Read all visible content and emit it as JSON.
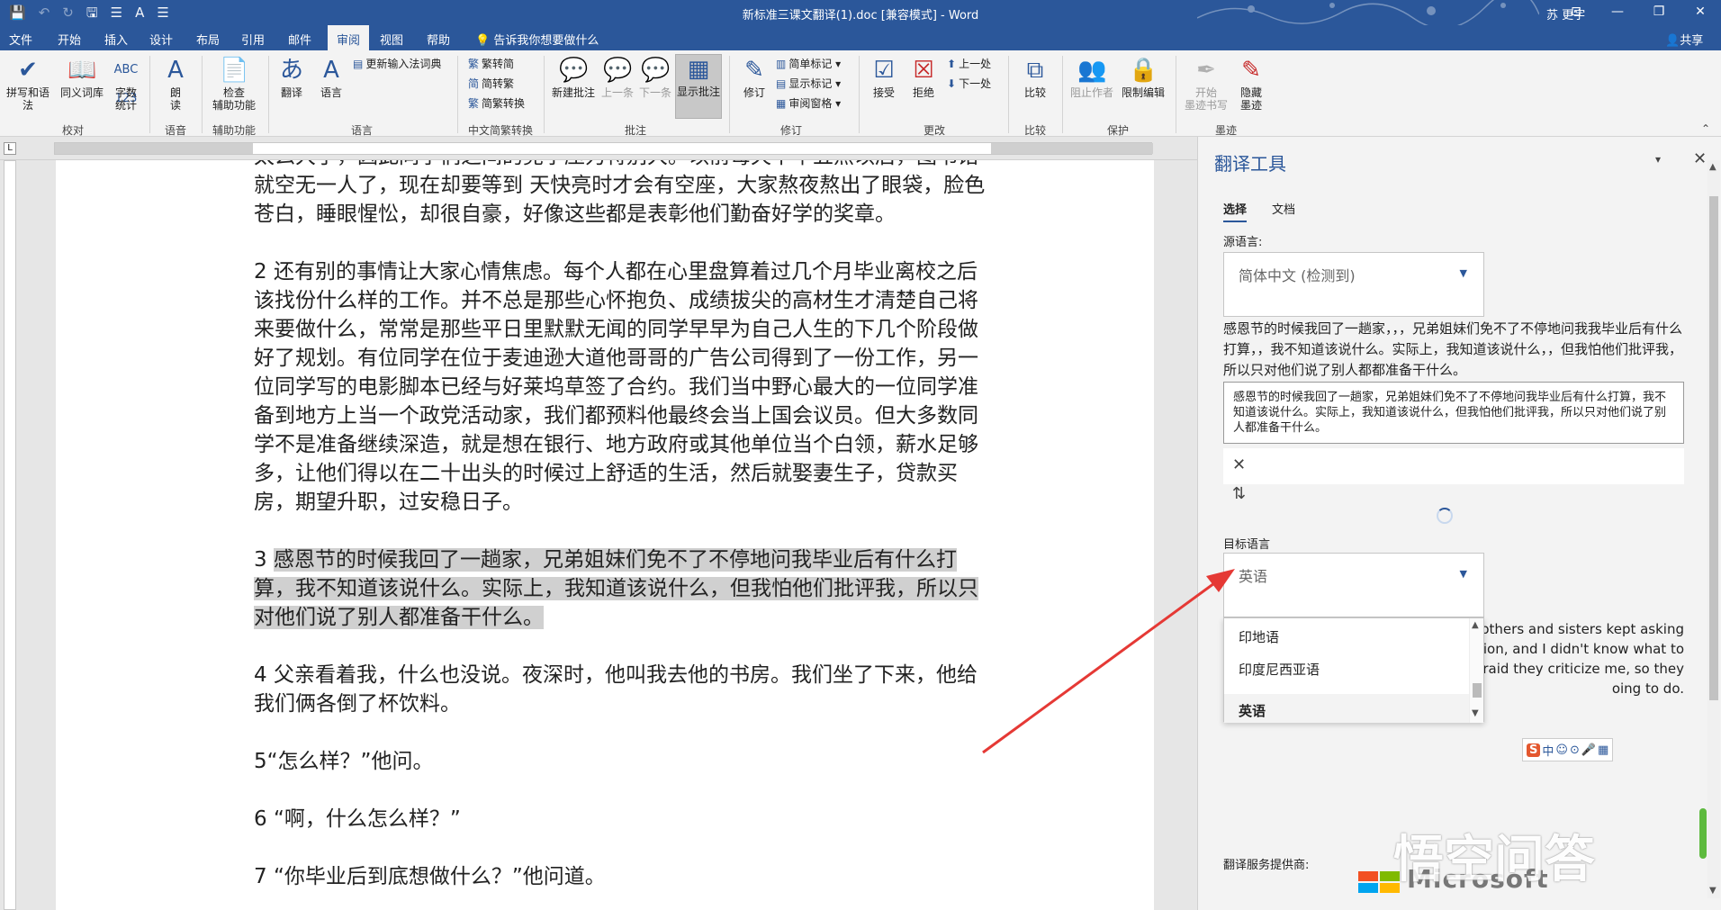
{
  "window": {
    "title": "新标准三课文翻译(1).doc [兼容模式] - Word",
    "user": "苏 更宇",
    "controls": [
      "⊡",
      "—",
      "❐",
      "✕"
    ]
  },
  "qat": [
    "💾",
    "↶",
    "↻",
    "🖫",
    "☰",
    "A",
    "☰"
  ],
  "tabs": [
    "文件",
    "开始",
    "插入",
    "设计",
    "布局",
    "引用",
    "邮件",
    "审阅",
    "视图",
    "帮助"
  ],
  "active_tab": "审阅",
  "tell_me": "告诉我你想要做什么",
  "share": "共享",
  "ribbon": {
    "proofing": {
      "spell": "拼写和语法",
      "thesaurus": "同义词库",
      "wordcount_l1": "字数",
      "wordcount_l2": "统计",
      "group": "校对"
    },
    "speech": {
      "read_l1": "朗",
      "read_l2": "读",
      "group": "语音"
    },
    "accessibility": {
      "check_l1": "检查",
      "check_l2": "辅助功能",
      "group": "辅助功能"
    },
    "language": {
      "translate": "翻译",
      "language": "语言",
      "ime_dict": "更新输入法词典",
      "group": "语言"
    },
    "chinese": {
      "t2s": "繁转简",
      "s2t": "简转繁",
      "convert": "简繁转换",
      "group": "中文简繁转换"
    },
    "comments": {
      "new": "新建批注",
      "prev": "上一条",
      "next": "下一条",
      "show": "显示批注",
      "group": "批注"
    },
    "tracking": {
      "track": "修订",
      "markup": "简单标记",
      "show_markup": "显示标记",
      "pane": "审阅窗格",
      "group": "修订"
    },
    "changes": {
      "accept": "接受",
      "reject": "拒绝",
      "prev": "上一处",
      "next": "下一处",
      "group": "更改"
    },
    "compare": {
      "compare": "比较",
      "group": "比较"
    },
    "protect": {
      "block_l1": "阻止作者",
      "restrict": "限制编辑",
      "group": "保护"
    },
    "ink": {
      "start_l1": "开始",
      "start_l2": "墨迹书写",
      "hide_l1": "隐藏",
      "hide_l2": "墨迹",
      "group": "墨迹"
    }
  },
  "document": {
    "paragraphs": [
      "太么大了，因此同学们之间的竞争压力特别大。以前每天下午五点以后，图书馆就空无一人了，现在却要等到 天快亮时才会有空座，大家熬夜熬出了眼袋，脸色苍白，睡眼惺忪，却很自豪，好像这些都是表彰他们勤奋好学的奖章。",
      "2 还有别的事情让大家心情焦虑。每个人都在心里盘算着过几个月毕业离校之后该找份什么样的工作。并不总是那些心怀抱负、成绩拔尖的高材生才清楚自己将来要做什么，常常是那些平日里默默无闻的同学早早为自己人生的下几个阶段做好了规划。有位同学在位于麦迪逊大道他哥哥的广告公司得到了一份工作，另一位同学写的电影脚本已经与好莱坞草签了合约。我们当中野心最大的一位同学准备到地方上当一个政党活动家，我们都预料他最终会当上国会议员。但大多数同学不是准备继续深造，就是想在银行、地方政府或其他单位当个白领，薪水足够多，让他们得以在二十出头的时候过上舒适的生活，然后就娶妻生子，贷款买房，期望升职，过安稳日子。",
      "感恩节的时候我回了一趟家，兄弟姐妹们免不了不停地问我毕业后有什么打算，我不知道该说什么。实际上，我知道该说什么，但我怕他们批评我，所以只对他们说了别人都准备干什么。",
      "4 父亲看着我，什么也没说。夜深时，他叫我去他的书房。我们坐了下来，他给我们俩各倒了杯饮料。",
      "5“怎么样？”他问。",
      "6 “啊，什么怎么样？”",
      "7 “你毕业后到底想做什么？”他问道。"
    ],
    "para3_num": "3 "
  },
  "pane": {
    "title": "翻译工具",
    "tabs": [
      "选择",
      "文档"
    ],
    "source_label": "源语言:",
    "source_value": "简体中文 (检测到)",
    "source_text": "感恩节的时候我回了一趟家，，，兄弟姐妹们免不了不停地问我我毕业后有什么打算，，我不知道该说什么。实际上，我知道该说什么，，但我怕他们批评我，所以只对他们说了别人都都准备干什么。",
    "selected_text": "感恩节的时候我回了一趟家，兄弟姐妹们免不了不停地问我毕业后有什么打算，我不知道该说什么。实际上，我知道该说什么，但我怕他们批评我，所以只对他们说了别人都准备干什么。",
    "target_label": "目标语言",
    "target_value": "英语",
    "dropdown_options": [
      "印地语",
      "印度尼西亚语",
      "英语"
    ],
    "dropdown_selected": "英语",
    "output_lines": [
      "rothers and sisters kept asking",
      "ion, and I didn't know what to",
      "fraid they criticize me, so they",
      "oing to do."
    ],
    "provider_label": "翻译服务提供商:",
    "provider_name": "Microsoft",
    "ime_items": [
      "S",
      "中",
      "☺",
      "⊙",
      "🎤",
      "▦"
    ]
  },
  "watermark": "悟空问答",
  "colors": {
    "brand": "#2b579a",
    "arrow": "#e53935"
  }
}
